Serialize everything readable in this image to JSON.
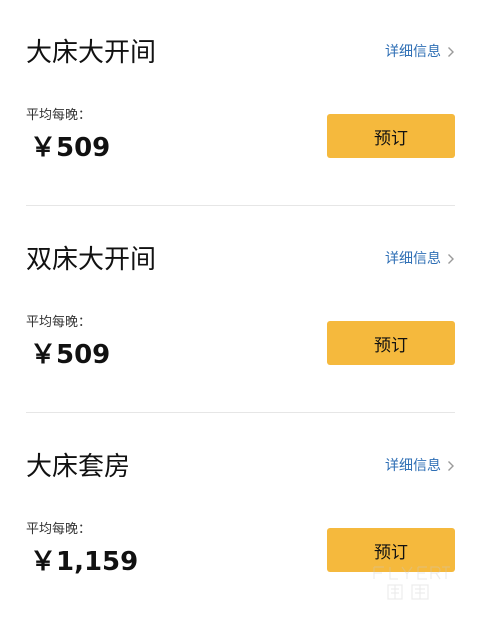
{
  "rooms": [
    {
      "name": "大床大开间",
      "details_label": "详细信息",
      "price_label": "平均每晚：",
      "price": "￥509",
      "book_label": "预订"
    },
    {
      "name": "双床大开间",
      "details_label": "详细信息",
      "price_label": "平均每晚：",
      "price": "￥509",
      "book_label": "预订"
    },
    {
      "name": "大床套房",
      "details_label": "详细信息",
      "price_label": "平均每晚：",
      "price": "￥1,159",
      "book_label": "预订"
    }
  ],
  "colors": {
    "accent_button": "#f5b93d",
    "link": "#2f6fb5",
    "divider": "#e6e6e6"
  },
  "icons": {
    "details_chevron": "chevron-right-icon",
    "watermark": "flyert-watermark"
  }
}
